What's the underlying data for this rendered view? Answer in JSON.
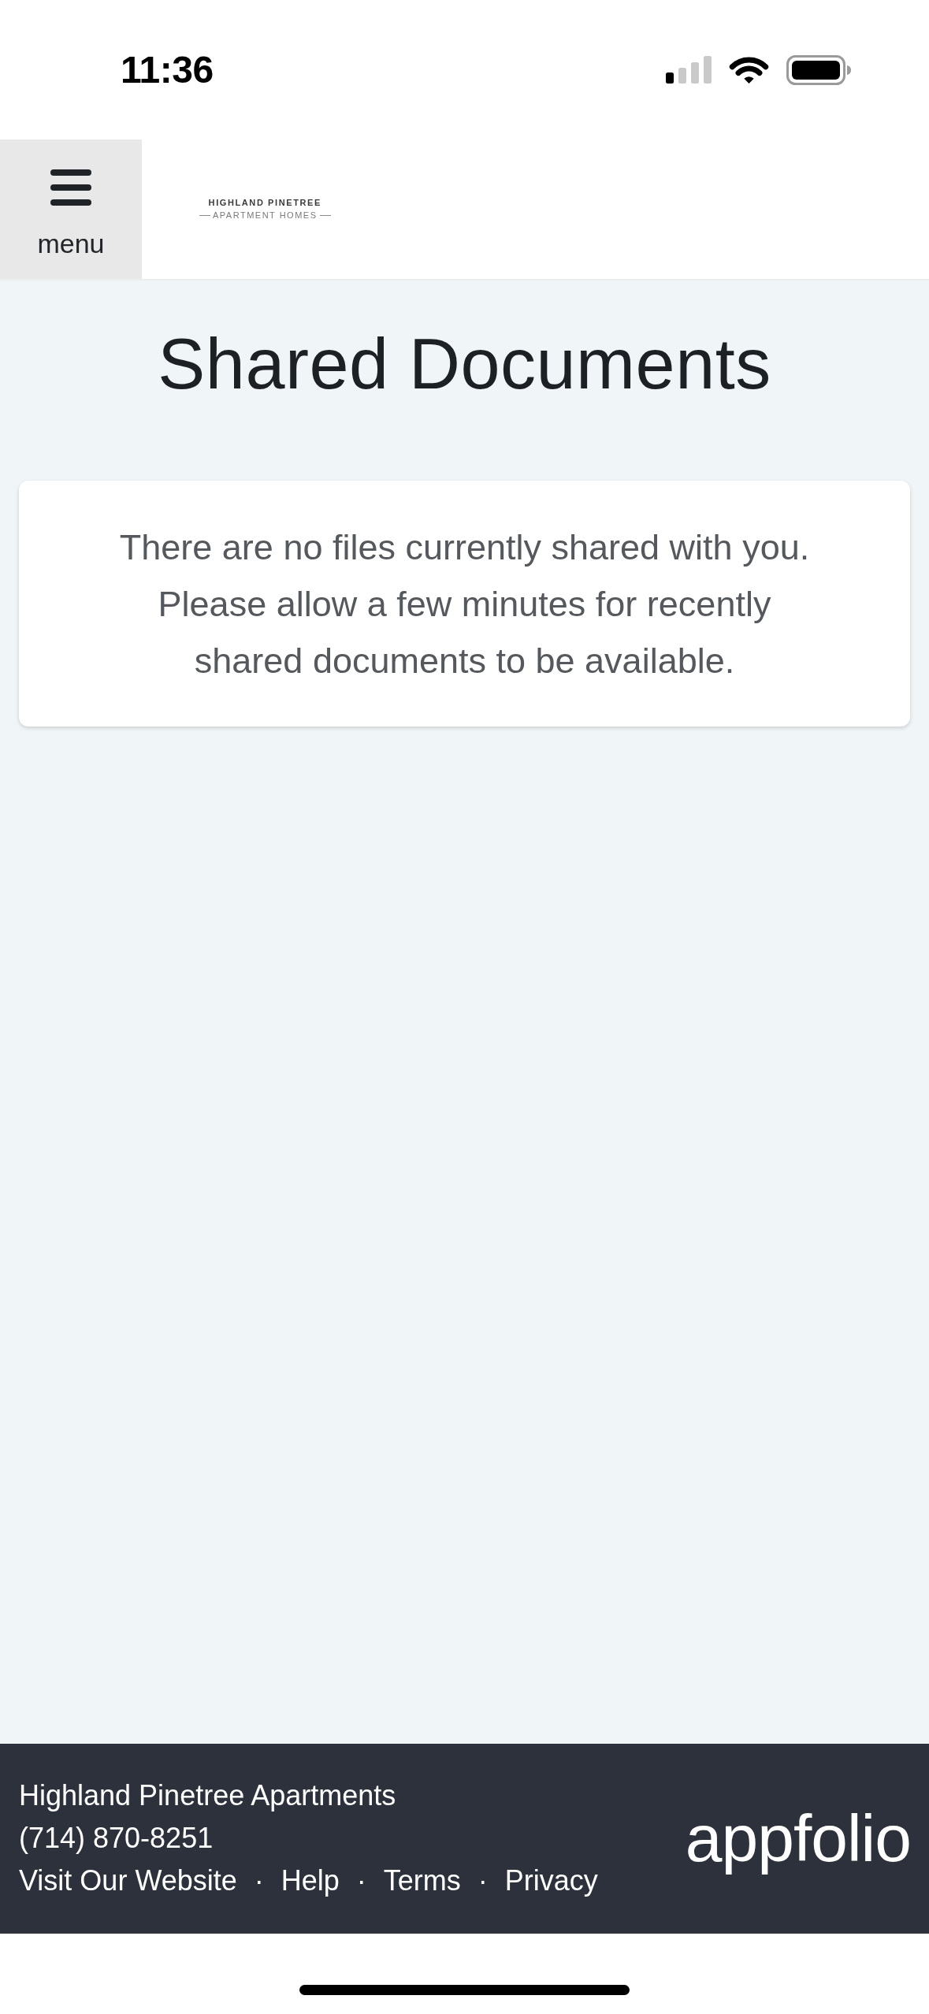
{
  "status_bar": {
    "time": "11:36"
  },
  "header": {
    "menu_button": {
      "label": "menu"
    },
    "logo": {
      "title": "HIGHLAND PINETREE",
      "subtitle": "APARTMENT HOMES"
    }
  },
  "page": {
    "title": "Shared Documents",
    "empty_message_lines": [
      "There are no files currently shared with you.",
      "Please allow a few minutes for recently",
      "shared documents to be available."
    ]
  },
  "footer": {
    "property_name": "Highland Pinetree Apartments",
    "phone": "(714) 870-8251",
    "links": [
      "Visit Our Website",
      "Help",
      "Terms",
      "Privacy"
    ],
    "link_separator": "·",
    "brand_logo": "appfolio"
  }
}
